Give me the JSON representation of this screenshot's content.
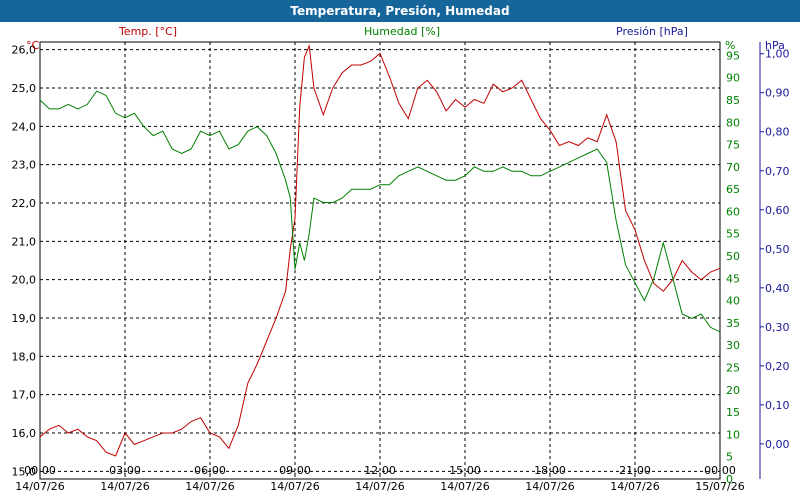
{
  "window": {
    "title": "Temperatura, Presión, Humedad"
  },
  "colors": {
    "temp": "#c00000",
    "hum": "#008000",
    "pres": "#1a1a9a",
    "grid": "#000000",
    "axis_text": "#000000"
  },
  "chart_data": {
    "type": "line",
    "title": "Temperatura, Presión, Humedad",
    "legend": {
      "temp": "Temp. [°C]",
      "hum": "Humedad [%]",
      "pres": "Presión [hPa]"
    },
    "grid": true,
    "x_ticks": [
      {
        "time": "00:00",
        "date": "14/07/26"
      },
      {
        "time": "03:00",
        "date": "14/07/26"
      },
      {
        "time": "06:00",
        "date": "14/07/26"
      },
      {
        "time": "09:00",
        "date": "14/07/26"
      },
      {
        "time": "12:00",
        "date": "14/07/26"
      },
      {
        "time": "15:00",
        "date": "14/07/26"
      },
      {
        "time": "18:00",
        "date": "14/07/26"
      },
      {
        "time": "21:00",
        "date": "14/07/26"
      },
      {
        "time": "00:00",
        "date": "15/07/26"
      }
    ],
    "xlim": [
      "14/07/26 00:00",
      "15/07/26 00:00"
    ],
    "axes": {
      "temp": {
        "unit": "°C",
        "ylim": [
          14.8,
          26.2
        ],
        "ticks": [
          "15,0",
          "16,0",
          "17,0",
          "18,0",
          "19,0",
          "20,0",
          "21,0",
          "22,0",
          "23,0",
          "24,0",
          "25,0",
          "26,0"
        ]
      },
      "hum": {
        "unit": "%",
        "ylim": [
          0,
          98
        ],
        "ticks": [
          "0",
          "5",
          "10",
          "15",
          "20",
          "25",
          "30",
          "35",
          "40",
          "45",
          "50",
          "55",
          "60",
          "65",
          "70",
          "75",
          "80",
          "85",
          "90",
          "95"
        ]
      },
      "pres": {
        "unit": "hPa",
        "ylim": [
          -0.09,
          1.03
        ],
        "ticks": [
          "0,00",
          "0,10",
          "0,20",
          "0,30",
          "0,40",
          "0,50",
          "0,60",
          "0,70",
          "0,80",
          "0,90",
          "1,00"
        ]
      }
    },
    "series": [
      {
        "name": "Temp. [°C]",
        "axis": "temp",
        "x": [
          "00:00",
          "00:20",
          "00:40",
          "01:00",
          "01:20",
          "01:40",
          "02:00",
          "02:20",
          "02:40",
          "03:00",
          "03:20",
          "03:40",
          "04:00",
          "04:20",
          "04:40",
          "05:00",
          "05:20",
          "05:40",
          "06:00",
          "06:20",
          "06:40",
          "07:00",
          "07:20",
          "07:40",
          "08:00",
          "08:20",
          "08:40",
          "08:50",
          "09:00",
          "09:10",
          "09:20",
          "09:30",
          "09:40",
          "10:00",
          "10:20",
          "10:40",
          "11:00",
          "11:20",
          "11:40",
          "12:00",
          "12:20",
          "12:40",
          "13:00",
          "13:20",
          "13:40",
          "14:00",
          "14:20",
          "14:40",
          "15:00",
          "15:20",
          "15:40",
          "16:00",
          "16:20",
          "16:40",
          "17:00",
          "17:20",
          "17:40",
          "18:00",
          "18:20",
          "18:40",
          "19:00",
          "19:20",
          "19:40",
          "20:00",
          "20:20",
          "20:40",
          "21:00",
          "21:20",
          "21:40",
          "22:00",
          "22:20",
          "22:40",
          "23:00",
          "23:20",
          "23:40",
          "24:00"
        ],
        "y": [
          15.9,
          16.1,
          16.2,
          16.0,
          16.1,
          15.9,
          15.8,
          15.5,
          15.4,
          16.0,
          15.7,
          15.8,
          15.9,
          16.0,
          16.0,
          16.1,
          16.3,
          16.4,
          16.0,
          15.9,
          15.6,
          16.2,
          17.3,
          17.8,
          18.4,
          19.0,
          19.7,
          20.8,
          21.6,
          24.5,
          25.8,
          26.1,
          25.0,
          24.3,
          25.0,
          25.4,
          25.6,
          25.6,
          25.7,
          25.9,
          25.3,
          24.6,
          24.2,
          25.0,
          25.2,
          24.9,
          24.4,
          24.7,
          24.5,
          24.7,
          24.6,
          25.1,
          24.9,
          25.0,
          25.2,
          24.7,
          24.2,
          23.9,
          23.5,
          23.6,
          23.5,
          23.7,
          23.6,
          24.3,
          23.6,
          21.8,
          21.3,
          20.5,
          19.9,
          19.7,
          20.0,
          20.5,
          20.2,
          20.0,
          20.2,
          20.3
        ]
      },
      {
        "name": "Humedad [%]",
        "axis": "hum",
        "x": [
          "00:00",
          "00:20",
          "00:40",
          "01:00",
          "01:20",
          "01:40",
          "02:00",
          "02:20",
          "02:40",
          "03:00",
          "03:20",
          "03:40",
          "04:00",
          "04:20",
          "04:40",
          "05:00",
          "05:20",
          "05:40",
          "06:00",
          "06:20",
          "06:40",
          "07:00",
          "07:20",
          "07:40",
          "08:00",
          "08:20",
          "08:40",
          "08:50",
          "09:00",
          "09:10",
          "09:20",
          "09:30",
          "09:40",
          "10:00",
          "10:20",
          "10:40",
          "11:00",
          "11:20",
          "11:40",
          "12:00",
          "12:20",
          "12:40",
          "13:00",
          "13:20",
          "13:40",
          "14:00",
          "14:20",
          "14:40",
          "15:00",
          "15:20",
          "15:40",
          "16:00",
          "16:20",
          "16:40",
          "17:00",
          "17:20",
          "17:40",
          "18:00",
          "18:20",
          "18:40",
          "19:00",
          "19:20",
          "19:40",
          "20:00",
          "20:20",
          "20:40",
          "21:00",
          "21:20",
          "21:40",
          "22:00",
          "22:20",
          "22:40",
          "23:00",
          "23:20",
          "23:40",
          "24:00"
        ],
        "y": [
          85,
          83,
          83,
          84,
          83,
          84,
          87,
          86,
          82,
          81,
          82,
          79,
          77,
          78,
          74,
          73,
          74,
          78,
          77,
          78,
          74,
          75,
          78,
          79,
          77,
          73,
          67,
          63,
          47,
          53,
          49,
          55,
          63,
          62,
          62,
          63,
          65,
          65,
          65,
          66,
          66,
          68,
          69,
          70,
          69,
          68,
          67,
          67,
          68,
          70,
          69,
          69,
          70,
          69,
          69,
          68,
          68,
          69,
          70,
          71,
          72,
          73,
          74,
          71,
          58,
          48,
          44,
          40,
          45,
          53,
          45,
          37,
          36,
          37,
          34,
          33
        ]
      }
    ]
  }
}
